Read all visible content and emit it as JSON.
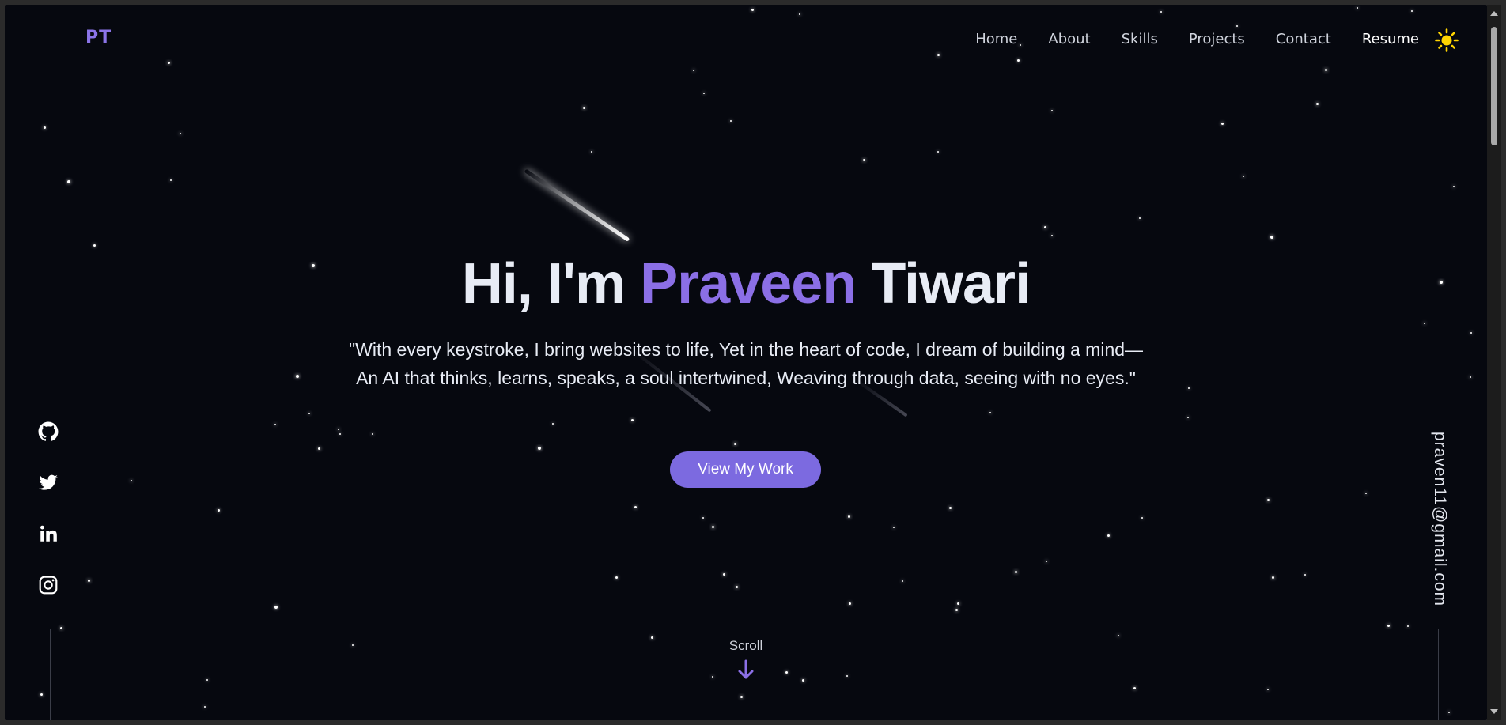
{
  "header": {
    "logo": "PT",
    "nav": [
      {
        "label": "Home"
      },
      {
        "label": "About"
      },
      {
        "label": "Skills"
      },
      {
        "label": "Projects"
      },
      {
        "label": "Contact"
      },
      {
        "label": "Resume"
      }
    ],
    "theme_icon": "sun-icon"
  },
  "hero": {
    "greeting": "Hi, I'm",
    "first_name": "Praveen",
    "last_name": "Tiwari",
    "quote": "\"With every keystroke, I bring websites to life, Yet in the heart of code, I dream of building a mind— An AI that thinks, learns, speaks, a soul intertwined, Weaving through data, seeing with no eyes.\"",
    "cta_label": "View My Work"
  },
  "social": [
    {
      "icon": "github-icon"
    },
    {
      "icon": "twitter-icon"
    },
    {
      "icon": "linkedin-icon"
    },
    {
      "icon": "instagram-icon"
    }
  ],
  "email": "praven11@gmail.com",
  "scroll": {
    "label": "Scroll",
    "icon": "arrow-down-icon"
  },
  "colors": {
    "background": "#06080f",
    "accent": "#8b6fe6",
    "button": "#7c6ae0",
    "sun": "#ffd400"
  }
}
